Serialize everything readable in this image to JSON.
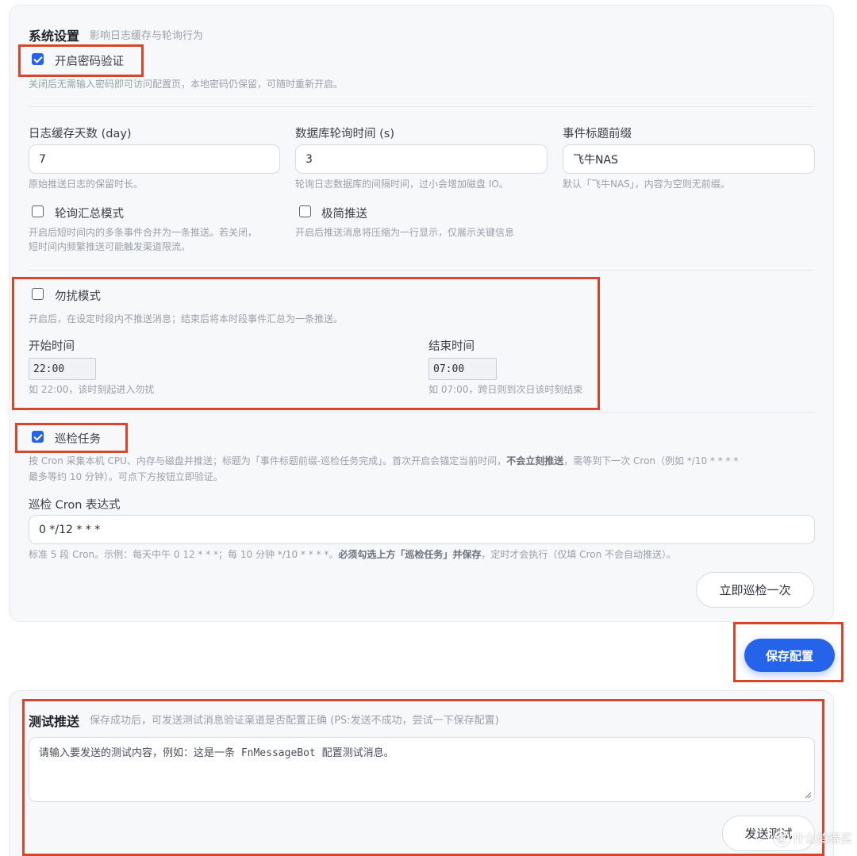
{
  "system_settings": {
    "title": "系统设置",
    "subtitle": "影响日志缓存与轮询行为",
    "password_verify": {
      "checked": true,
      "label": "开启密码验证",
      "hint": "关闭后无需输入密码即可访问配置页，本地密码仍保留，可随时重新开启。"
    },
    "log_cache_days": {
      "label": "日志缓存天数 (day)",
      "value": "7",
      "hint": "原始推送日志的保留时长。"
    },
    "db_poll_interval": {
      "label": "数据库轮询时间 (s)",
      "value": "3",
      "hint": "轮询日志数据库的间隔时间，过小会增加磁盘 IO。"
    },
    "event_title_prefix": {
      "label": "事件标题前缀",
      "value": "飞牛NAS",
      "hint": "默认「飞牛NAS」，内容为空则无前缀。"
    },
    "poll_summary_mode": {
      "checked": false,
      "label": "轮询汇总模式",
      "hint_line1": "开启后短时间内的多条事件合并为一条推送。若关闭，",
      "hint_line2": "短时间内频繁推送可能触发渠道限流。"
    },
    "minimal_push": {
      "checked": false,
      "label": "极简推送",
      "hint": "开启后推送消息将压缩为一行显示，仅展示关键信息"
    },
    "do_not_disturb": {
      "checked": false,
      "label": "勿扰模式",
      "hint": "开启后，在设定时段内不推送消息；结束后将本时段事件汇总为一条推送。",
      "start_label": "开始时间",
      "start_value": "22:00",
      "start_hint": "如 22:00，该时刻起进入勿扰",
      "end_label": "结束时间",
      "end_value": "07:00",
      "end_hint": "如 07:00，跨日则到次日该时刻结束"
    },
    "inspection_task": {
      "checked": true,
      "label": "巡检任务",
      "hint_part1": "按 Cron 采集本机 CPU、内存与磁盘并推送；标题为「事件标题前缀-巡检任务完成」。首次开启会锚定当前时间，",
      "hint_bold": "不会立刻推送",
      "hint_part2": "，需等到下一次 Cron（例如 */10 * * * *",
      "hint_line2": "最多等约 10 分钟）。可点下方按钮立即验证。",
      "cron_label": "巡检 Cron 表达式",
      "cron_value": "0 */12 * * *",
      "cron_hint_part1": "标准 5 段 Cron。示例：每天中午 0 12 * * *；每 10 分钟 */10 * * * *。",
      "cron_hint_bold": "必须勾选上方「巡检任务」并保存",
      "cron_hint_part2": "，定时才会执行（仅填 Cron 不会自动推送）。",
      "run_now_button": "立即巡检一次"
    }
  },
  "save_button": "保存配置",
  "test_push": {
    "title": "测试推送",
    "subtitle": "保存成功后，可发送测试消息验证渠道是否配置正确 (PS:发送不成功，尝试一下保存配置)",
    "textarea_placeholder": "请输入要发送的测试内容，例如：这是一条 FnMessageBot 配置测试消息。",
    "send_button": "发送测试"
  },
  "watermark": {
    "logo_text": "值",
    "text": "什么值得买"
  },
  "colors": {
    "accent": "#2563eb",
    "highlight_box": "#d8452b",
    "card_bg": "#f7f8fa"
  }
}
